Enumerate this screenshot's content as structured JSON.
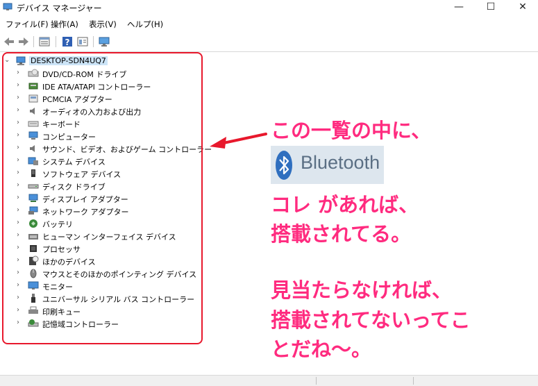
{
  "window": {
    "title": "デバイス マネージャー",
    "minimize": "—",
    "maximize": "☐",
    "close": "✕"
  },
  "menu": [
    "ファイル(F)",
    "操作(A)",
    "表示(V)",
    "ヘルプ(H)"
  ],
  "tree": {
    "root": "DESKTOP-SDN4UQ7",
    "items": [
      {
        "label": "DVD/CD-ROM ドライブ",
        "icon": "dvd-drive-icon"
      },
      {
        "label": "IDE ATA/ATAPI コントローラー",
        "icon": "ide-controller-icon"
      },
      {
        "label": "PCMCIA アダプター",
        "icon": "pcmcia-adapter-icon"
      },
      {
        "label": "オーディオの入力および出力",
        "icon": "speaker-icon"
      },
      {
        "label": "キーボード",
        "icon": "keyboard-icon"
      },
      {
        "label": "コンピューター",
        "icon": "computer-icon"
      },
      {
        "label": "サウンド、ビデオ、およびゲーム コントローラー",
        "icon": "sound-icon"
      },
      {
        "label": "システム デバイス",
        "icon": "system-device-icon"
      },
      {
        "label": "ソフトウェア デバイス",
        "icon": "software-device-icon"
      },
      {
        "label": "ディスク ドライブ",
        "icon": "disk-drive-icon"
      },
      {
        "label": "ディスプレイ アダプター",
        "icon": "display-adapter-icon"
      },
      {
        "label": "ネットワーク アダプター",
        "icon": "network-adapter-icon"
      },
      {
        "label": "バッテリ",
        "icon": "battery-icon"
      },
      {
        "label": "ヒューマン インターフェイス デバイス",
        "icon": "hid-icon"
      },
      {
        "label": "プロセッサ",
        "icon": "processor-icon"
      },
      {
        "label": "ほかのデバイス",
        "icon": "other-device-icon"
      },
      {
        "label": "マウスとそのほかのポインティング デバイス",
        "icon": "mouse-icon"
      },
      {
        "label": "モニター",
        "icon": "monitor-icon"
      },
      {
        "label": "ユニバーサル シリアル バス コントローラー",
        "icon": "usb-icon"
      },
      {
        "label": "印刷キュー",
        "icon": "printer-icon"
      },
      {
        "label": "記憶域コントローラー",
        "icon": "storage-controller-icon"
      }
    ]
  },
  "annotation": {
    "line1": "この一覧の中に、",
    "bluetooth": "Bluetooth",
    "line2": "コレ があれば、",
    "line3": "搭載されてる。",
    "line4": "見当たらなければ、",
    "line5": "搭載されてないってこ",
    "line6": "とだね〜。"
  },
  "colors": {
    "annotation": "#ff2b7f",
    "highlight_box": "#e8182c",
    "selection": "#cce4f7"
  }
}
